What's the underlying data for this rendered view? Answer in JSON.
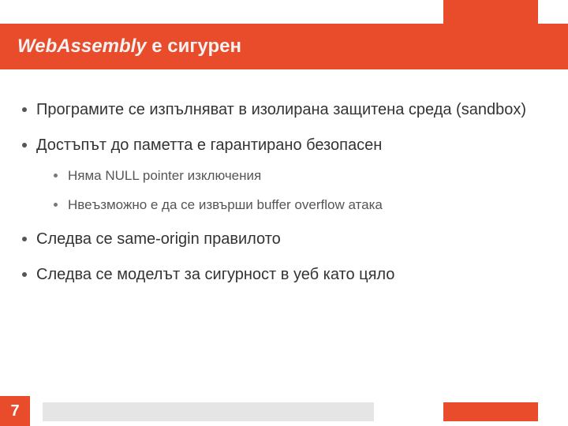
{
  "slide": {
    "title_em": "WebAssembly",
    "title_rest": " е сигурен",
    "bullets": [
      {
        "text": "Програмите се изпълняват в изолирана защитена среда (sandbox)"
      },
      {
        "text": "Достъпът до паметта е гарантирано безопасен",
        "sub": [
          "Няма NULL pointer изключения",
          "Нвеъзможно е да се извърши buffer overflow атака"
        ]
      },
      {
        "text": "Следва се same-origin правилото"
      },
      {
        "text": "Следва се моделът за сигурност в уеб като цяло"
      }
    ],
    "page_number": "7"
  },
  "colors": {
    "accent": "#e84c2b",
    "gray": "#e5e5e5"
  }
}
